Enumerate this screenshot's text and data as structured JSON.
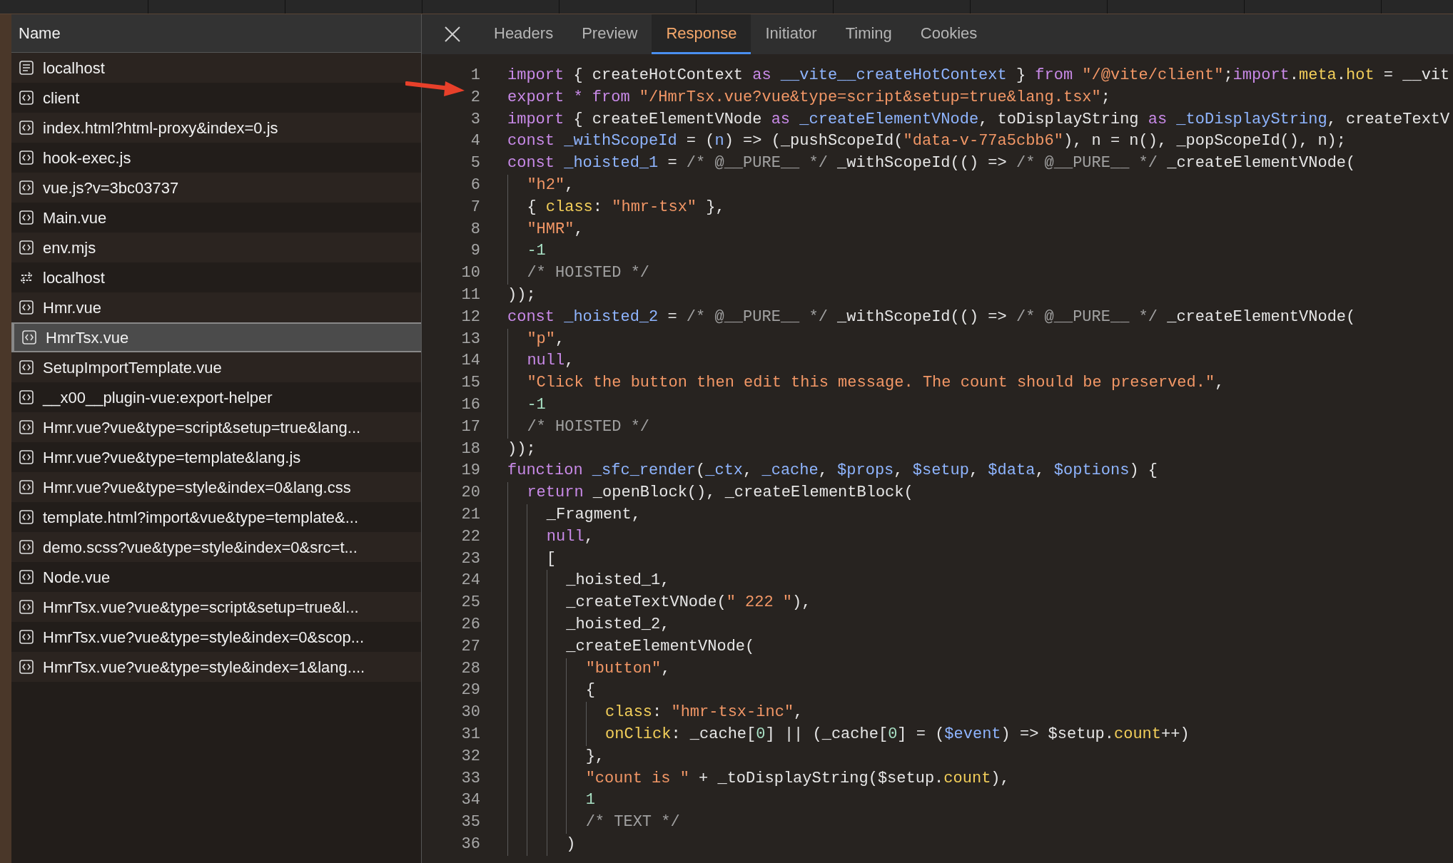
{
  "requests": {
    "header": "Name",
    "items": [
      {
        "name": "localhost",
        "kind": "document",
        "selected": false
      },
      {
        "name": "client",
        "kind": "script",
        "selected": false
      },
      {
        "name": "index.html?html-proxy&index=0.js",
        "kind": "script",
        "selected": false
      },
      {
        "name": "hook-exec.js",
        "kind": "script",
        "selected": false
      },
      {
        "name": "vue.js?v=3bc03737",
        "kind": "script",
        "selected": false
      },
      {
        "name": "Main.vue",
        "kind": "script",
        "selected": false
      },
      {
        "name": "env.mjs",
        "kind": "script",
        "selected": false
      },
      {
        "name": "localhost",
        "kind": "redirect",
        "selected": false
      },
      {
        "name": "Hmr.vue",
        "kind": "script",
        "selected": false
      },
      {
        "name": "HmrTsx.vue",
        "kind": "script",
        "selected": true
      },
      {
        "name": "SetupImportTemplate.vue",
        "kind": "script",
        "selected": false
      },
      {
        "name": "__x00__plugin-vue:export-helper",
        "kind": "script",
        "selected": false
      },
      {
        "name": "Hmr.vue?vue&type=script&setup=true&lang...",
        "kind": "script",
        "selected": false
      },
      {
        "name": "Hmr.vue?vue&type=template&lang.js",
        "kind": "script",
        "selected": false
      },
      {
        "name": "Hmr.vue?vue&type=style&index=0&lang.css",
        "kind": "script",
        "selected": false
      },
      {
        "name": "template.html?import&vue&type=template&...",
        "kind": "script",
        "selected": false
      },
      {
        "name": "demo.scss?vue&type=style&index=0&src=t...",
        "kind": "script",
        "selected": false
      },
      {
        "name": "Node.vue",
        "kind": "script",
        "selected": false
      },
      {
        "name": "HmrTsx.vue?vue&type=script&setup=true&l...",
        "kind": "script",
        "selected": false
      },
      {
        "name": "HmrTsx.vue?vue&type=style&index=0&scop...",
        "kind": "script",
        "selected": false
      },
      {
        "name": "HmrTsx.vue?vue&type=style&index=1&lang....",
        "kind": "script",
        "selected": false
      }
    ]
  },
  "detail": {
    "tabs": [
      {
        "label": "Headers",
        "selected": false
      },
      {
        "label": "Preview",
        "selected": false
      },
      {
        "label": "Response",
        "selected": true
      },
      {
        "label": "Initiator",
        "selected": false
      },
      {
        "label": "Timing",
        "selected": false
      },
      {
        "label": "Cookies",
        "selected": false
      }
    ],
    "code": [
      {
        "number": "1",
        "tokens": [
          {
            "kind": "keyword",
            "text": "import"
          },
          {
            "kind": "plain",
            "text": " { createHotContext "
          },
          {
            "kind": "keyword",
            "text": "as"
          },
          {
            "kind": "variable",
            "text": " __vite__createHotContext"
          },
          {
            "kind": "plain",
            "text": " } "
          },
          {
            "kind": "keyword",
            "text": "from"
          },
          {
            "kind": "string",
            "text": " \"/@vite/client\""
          },
          {
            "kind": "plain",
            "text": ";"
          },
          {
            "kind": "keyword",
            "text": "import"
          },
          {
            "kind": "plain",
            "text": "."
          },
          {
            "kind": "property",
            "text": "meta"
          },
          {
            "kind": "plain",
            "text": "."
          },
          {
            "kind": "property",
            "text": "hot"
          },
          {
            "kind": "plain",
            "text": " = __vit"
          }
        ]
      },
      {
        "number": "2",
        "tokens": [
          {
            "kind": "keyword",
            "text": "export * from"
          },
          {
            "kind": "string",
            "text": " \"/HmrTsx.vue?vue&type=script&setup=true&lang.tsx\""
          },
          {
            "kind": "plain",
            "text": ";"
          }
        ]
      },
      {
        "number": "3",
        "tokens": [
          {
            "kind": "keyword",
            "text": "import"
          },
          {
            "kind": "plain",
            "text": " { createElementVNode "
          },
          {
            "kind": "keyword",
            "text": "as"
          },
          {
            "kind": "variable",
            "text": " _createElementVNode"
          },
          {
            "kind": "plain",
            "text": ", toDisplayString "
          },
          {
            "kind": "keyword",
            "text": "as"
          },
          {
            "kind": "variable",
            "text": " _toDisplayString"
          },
          {
            "kind": "plain",
            "text": ", createTextV"
          }
        ]
      },
      {
        "number": "4",
        "tokens": [
          {
            "kind": "keyword",
            "text": "const"
          },
          {
            "kind": "variable",
            "text": " _withScopeId"
          },
          {
            "kind": "plain",
            "text": " = ("
          },
          {
            "kind": "variable",
            "text": "n"
          },
          {
            "kind": "plain",
            "text": ") => (_pushScopeId("
          },
          {
            "kind": "string",
            "text": "\"data-v-77a5cbb6\""
          },
          {
            "kind": "plain",
            "text": "), n = n(), _popScopeId(), n);"
          }
        ]
      },
      {
        "number": "5",
        "tokens": [
          {
            "kind": "keyword",
            "text": "const"
          },
          {
            "kind": "variable",
            "text": " _hoisted_1"
          },
          {
            "kind": "plain",
            "text": " = "
          },
          {
            "kind": "comment",
            "text": "/* @__PURE__ */"
          },
          {
            "kind": "plain",
            "text": " _withScopeId(() => "
          },
          {
            "kind": "comment",
            "text": "/* @__PURE__ */"
          },
          {
            "kind": "plain",
            "text": " _createElementVNode("
          }
        ]
      },
      {
        "number": "6",
        "tokens": [
          {
            "kind": "string",
            "text": "  \"h2\""
          },
          {
            "kind": "plain",
            "text": ","
          }
        ]
      },
      {
        "number": "7",
        "tokens": [
          {
            "kind": "plain",
            "text": "  { "
          },
          {
            "kind": "property",
            "text": "class"
          },
          {
            "kind": "plain",
            "text": ": "
          },
          {
            "kind": "string",
            "text": "\"hmr-tsx\""
          },
          {
            "kind": "plain",
            "text": " },"
          }
        ]
      },
      {
        "number": "8",
        "tokens": [
          {
            "kind": "string",
            "text": "  \"HMR\""
          },
          {
            "kind": "plain",
            "text": ","
          }
        ]
      },
      {
        "number": "9",
        "tokens": [
          {
            "kind": "number",
            "text": "  -1"
          }
        ]
      },
      {
        "number": "10",
        "tokens": [
          {
            "kind": "comment",
            "text": "  /* HOISTED */"
          }
        ]
      },
      {
        "number": "11",
        "tokens": [
          {
            "kind": "plain",
            "text": "));"
          }
        ]
      },
      {
        "number": "12",
        "tokens": [
          {
            "kind": "keyword",
            "text": "const"
          },
          {
            "kind": "variable",
            "text": " _hoisted_2"
          },
          {
            "kind": "plain",
            "text": " = "
          },
          {
            "kind": "comment",
            "text": "/* @__PURE__ */"
          },
          {
            "kind": "plain",
            "text": " _withScopeId(() => "
          },
          {
            "kind": "comment",
            "text": "/* @__PURE__ */"
          },
          {
            "kind": "plain",
            "text": " _createElementVNode("
          }
        ]
      },
      {
        "number": "13",
        "tokens": [
          {
            "kind": "string",
            "text": "  \"p\""
          },
          {
            "kind": "plain",
            "text": ","
          }
        ]
      },
      {
        "number": "14",
        "tokens": [
          {
            "kind": "keyword",
            "text": "  null"
          },
          {
            "kind": "plain",
            "text": ","
          }
        ]
      },
      {
        "number": "15",
        "tokens": [
          {
            "kind": "string",
            "text": "  \"Click the button then edit this message. The count should be preserved.\""
          },
          {
            "kind": "plain",
            "text": ","
          }
        ]
      },
      {
        "number": "16",
        "tokens": [
          {
            "kind": "number",
            "text": "  -1"
          }
        ]
      },
      {
        "number": "17",
        "tokens": [
          {
            "kind": "comment",
            "text": "  /* HOISTED */"
          }
        ]
      },
      {
        "number": "18",
        "tokens": [
          {
            "kind": "plain",
            "text": "));"
          }
        ]
      },
      {
        "number": "19",
        "tokens": [
          {
            "kind": "keyword",
            "text": "function"
          },
          {
            "kind": "variable",
            "text": " _sfc_render"
          },
          {
            "kind": "plain",
            "text": "("
          },
          {
            "kind": "variable",
            "text": "_ctx"
          },
          {
            "kind": "plain",
            "text": ", "
          },
          {
            "kind": "variable",
            "text": "_cache"
          },
          {
            "kind": "plain",
            "text": ", "
          },
          {
            "kind": "variable",
            "text": "$props"
          },
          {
            "kind": "plain",
            "text": ", "
          },
          {
            "kind": "variable",
            "text": "$setup"
          },
          {
            "kind": "plain",
            "text": ", "
          },
          {
            "kind": "variable",
            "text": "$data"
          },
          {
            "kind": "plain",
            "text": ", "
          },
          {
            "kind": "variable",
            "text": "$options"
          },
          {
            "kind": "plain",
            "text": ") {"
          }
        ]
      },
      {
        "number": "20",
        "tokens": [
          {
            "kind": "keyword",
            "text": "  return"
          },
          {
            "kind": "plain",
            "text": " _openBlock(), _createElementBlock("
          }
        ]
      },
      {
        "number": "21",
        "tokens": [
          {
            "kind": "plain",
            "text": "    _Fragment,"
          }
        ]
      },
      {
        "number": "22",
        "tokens": [
          {
            "kind": "keyword",
            "text": "    null"
          },
          {
            "kind": "plain",
            "text": ","
          }
        ]
      },
      {
        "number": "23",
        "tokens": [
          {
            "kind": "plain",
            "text": "    ["
          }
        ]
      },
      {
        "number": "24",
        "tokens": [
          {
            "kind": "plain",
            "text": "      _hoisted_1,"
          }
        ]
      },
      {
        "number": "25",
        "tokens": [
          {
            "kind": "plain",
            "text": "      _createTextVNode("
          },
          {
            "kind": "string",
            "text": "\" 222 \""
          },
          {
            "kind": "plain",
            "text": "),"
          }
        ]
      },
      {
        "number": "26",
        "tokens": [
          {
            "kind": "plain",
            "text": "      _hoisted_2,"
          }
        ]
      },
      {
        "number": "27",
        "tokens": [
          {
            "kind": "plain",
            "text": "      _createElementVNode("
          }
        ]
      },
      {
        "number": "28",
        "tokens": [
          {
            "kind": "string",
            "text": "        \"button\""
          },
          {
            "kind": "plain",
            "text": ","
          }
        ]
      },
      {
        "number": "29",
        "tokens": [
          {
            "kind": "plain",
            "text": "        {"
          }
        ]
      },
      {
        "number": "30",
        "tokens": [
          {
            "kind": "property",
            "text": "          class"
          },
          {
            "kind": "plain",
            "text": ": "
          },
          {
            "kind": "string",
            "text": "\"hmr-tsx-inc\""
          },
          {
            "kind": "plain",
            "text": ","
          }
        ]
      },
      {
        "number": "31",
        "tokens": [
          {
            "kind": "property",
            "text": "          onClick"
          },
          {
            "kind": "plain",
            "text": ": _cache["
          },
          {
            "kind": "number",
            "text": "0"
          },
          {
            "kind": "plain",
            "text": "] || (_cache["
          },
          {
            "kind": "number",
            "text": "0"
          },
          {
            "kind": "plain",
            "text": "] = ("
          },
          {
            "kind": "variable",
            "text": "$event"
          },
          {
            "kind": "plain",
            "text": ") => $setup."
          },
          {
            "kind": "property",
            "text": "count"
          },
          {
            "kind": "plain",
            "text": "++)"
          }
        ]
      },
      {
        "number": "32",
        "tokens": [
          {
            "kind": "plain",
            "text": "        },"
          }
        ]
      },
      {
        "number": "33",
        "tokens": [
          {
            "kind": "string",
            "text": "        \"count is \""
          },
          {
            "kind": "plain",
            "text": " + _toDisplayString($setup."
          },
          {
            "kind": "property",
            "text": "count"
          },
          {
            "kind": "plain",
            "text": "),"
          }
        ]
      },
      {
        "number": "34",
        "tokens": [
          {
            "kind": "number",
            "text": "        1"
          }
        ]
      },
      {
        "number": "35",
        "tokens": [
          {
            "kind": "comment",
            "text": "        /* TEXT */"
          }
        ]
      },
      {
        "number": "36",
        "tokens": [
          {
            "kind": "plain",
            "text": "      )"
          }
        ]
      }
    ]
  }
}
